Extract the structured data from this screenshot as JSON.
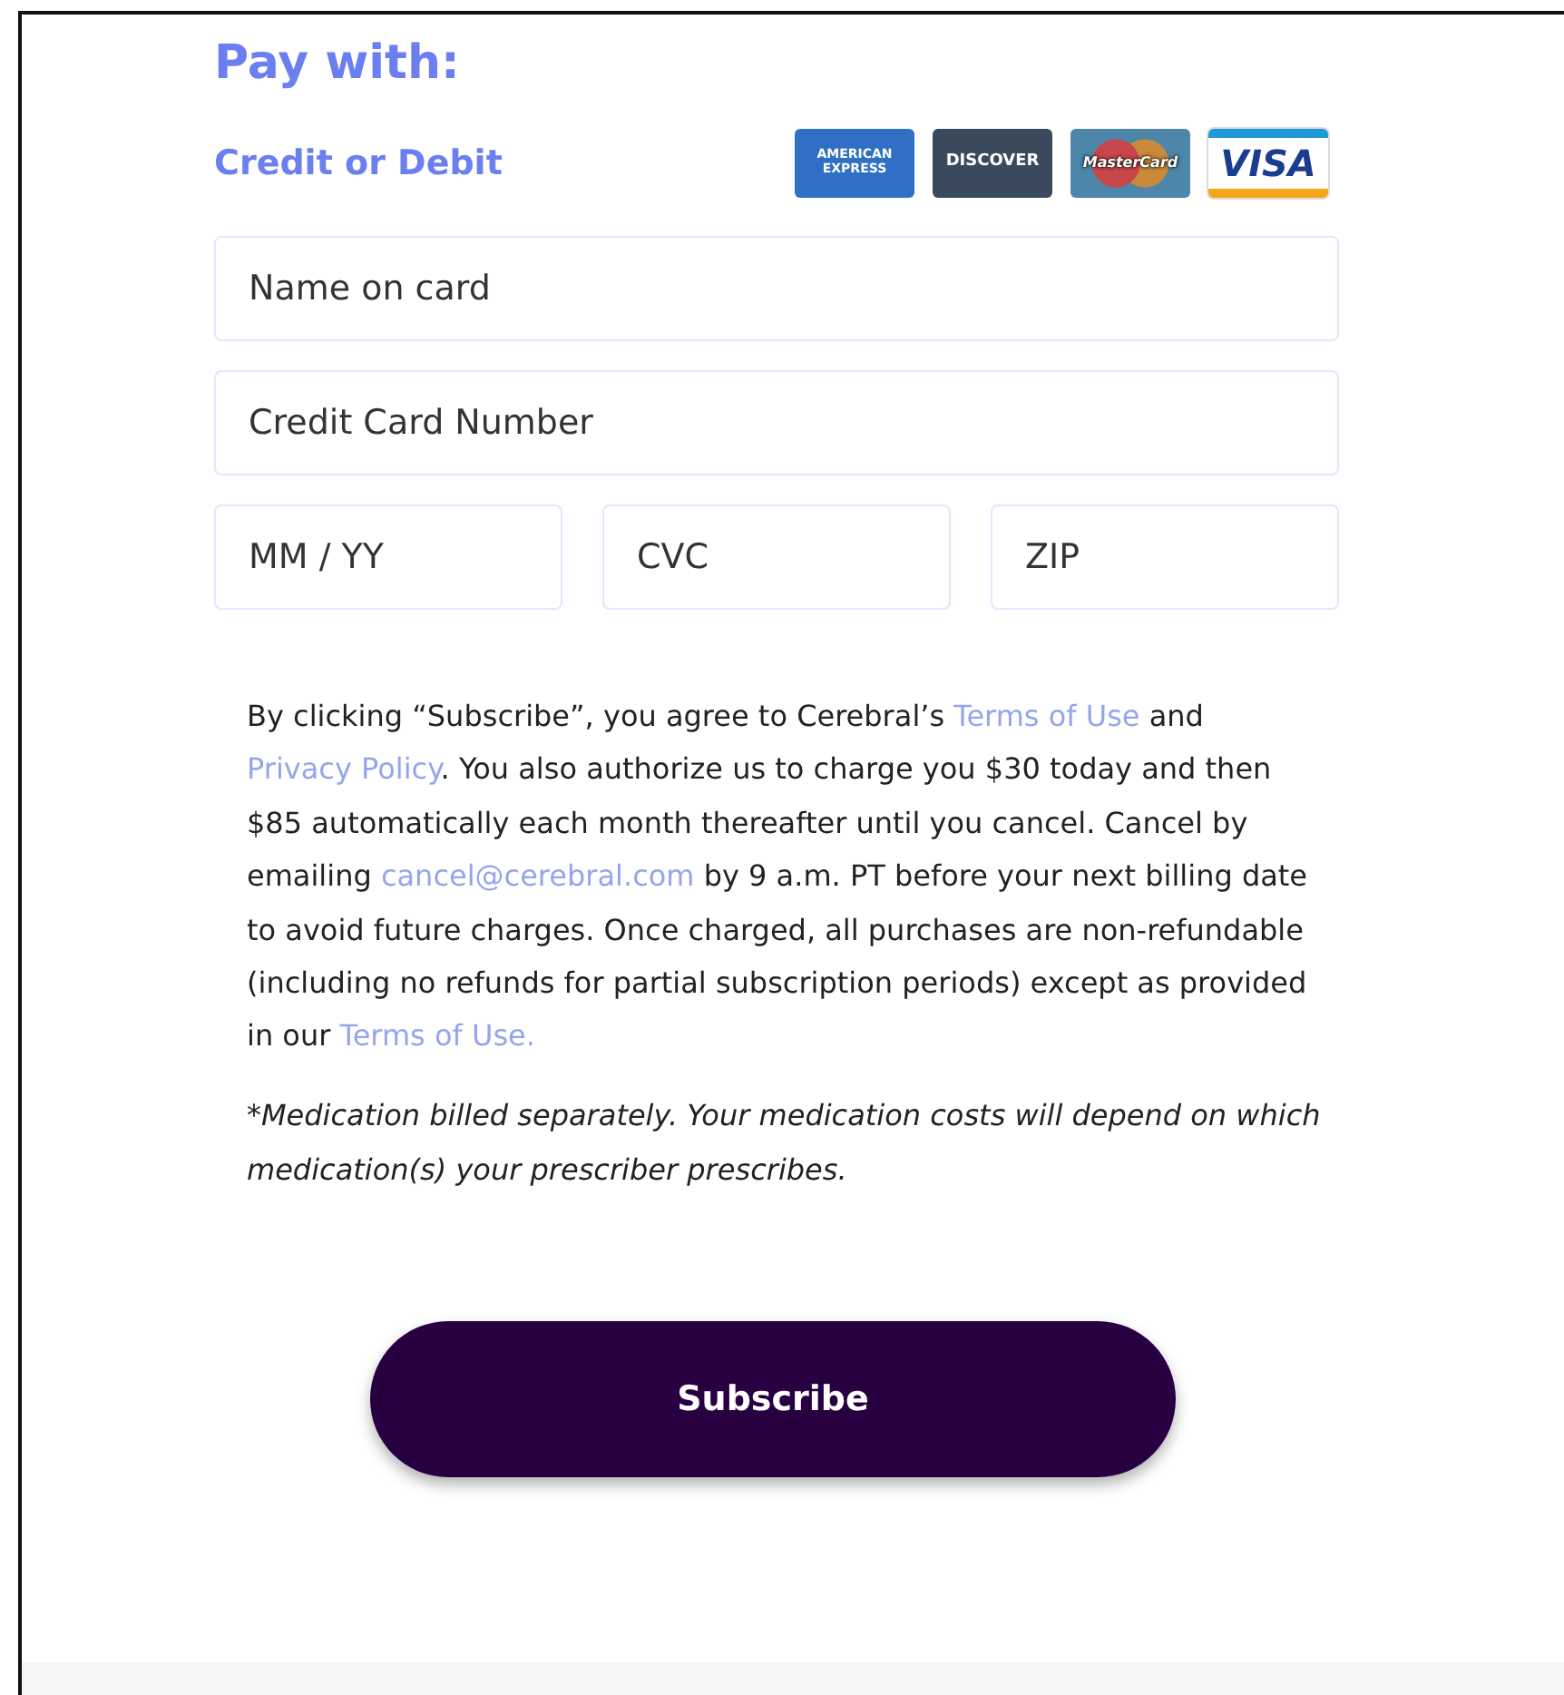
{
  "heading": "Pay with:",
  "method_label": "Credit or Debit",
  "card_brands": [
    {
      "kind": "amex",
      "label": "AMERICAN EXPRESS"
    },
    {
      "kind": "discover",
      "label": "DISCOVER"
    },
    {
      "kind": "mastercard",
      "label": "MasterCard"
    },
    {
      "kind": "visa",
      "label": "VISA"
    }
  ],
  "fields": [
    [
      {
        "placeholder": "Name on card"
      }
    ],
    [
      {
        "placeholder": "Credit Card Number"
      }
    ],
    [
      {
        "placeholder": "MM / YY"
      },
      {
        "placeholder": "CVC"
      },
      {
        "placeholder": "ZIP"
      }
    ]
  ],
  "terms": [
    {
      "kind": "text",
      "text": "By clicking “Subscribe”, you agree to Cerebral’s "
    },
    {
      "kind": "link",
      "text": "Terms of Use"
    },
    {
      "kind": "text",
      "text": " and "
    },
    {
      "kind": "link",
      "text": "Privacy Policy"
    },
    {
      "kind": "text",
      "text": ". You also authorize us to charge you $30 today and then $85 automatically each month thereafter until you cancel. Cancel by emailing "
    },
    {
      "kind": "link",
      "text": "cancel@cerebral.com"
    },
    {
      "kind": "text",
      "text": " by 9 a.m. PT before your next billing date to avoid future charges. Once charged, all purchases are non-refundable (including no refunds for partial subscription periods) except as provided in our "
    },
    {
      "kind": "link",
      "text": "Terms of Use."
    }
  ],
  "note": "*Medication billed separately. Your medication costs will depend on which medication(s) your prescriber prescribes.",
  "button": "Subscribe"
}
